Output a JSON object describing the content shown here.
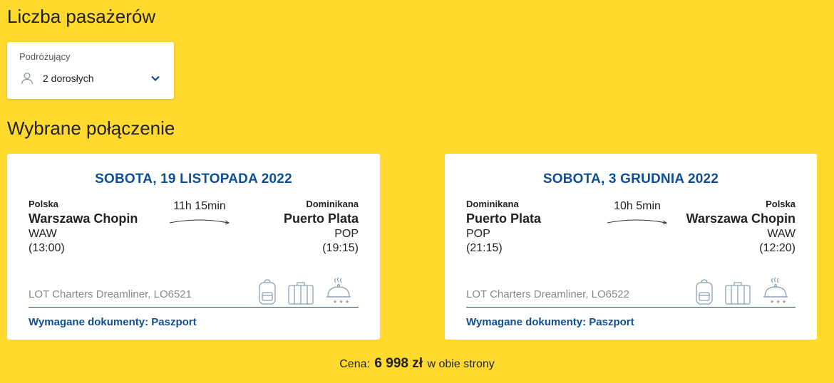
{
  "passengers": {
    "title": "Liczba pasażerów",
    "label": "Podróżujący",
    "value": "2 dorosłych"
  },
  "selected": {
    "title": "Wybrane połączenie"
  },
  "flights": [
    {
      "date": "SOBOTA, 19 LISTOPADA 2022",
      "from": {
        "country": "Polska",
        "city": "Warszawa Chopin",
        "code": "WAW",
        "time": "(13:00)"
      },
      "to": {
        "country": "Dominikana",
        "city": "Puerto Plata",
        "code": "POP",
        "time": "(19:15)"
      },
      "duration": "11h 15min",
      "flight": "LOT Charters Dreamliner, LO6521",
      "documents": "Wymagane dokumenty: Paszport"
    },
    {
      "date": "SOBOTA, 3 GRUDNIA 2022",
      "from": {
        "country": "Dominikana",
        "city": "Puerto Plata",
        "code": "POP",
        "time": "(21:15)"
      },
      "to": {
        "country": "Polska",
        "city": "Warszawa Chopin",
        "code": "WAW",
        "time": "(12:20)"
      },
      "duration": "10h 5min",
      "flight": "LOT Charters Dreamliner, LO6522",
      "documents": "Wymagane dokumenty: Paszport"
    }
  ],
  "price": {
    "label": "Cena:",
    "amount": "6 998 zł",
    "suffix": "w obie strony"
  },
  "colors": {
    "background": "#FFD92E",
    "accent": "#0E4E96"
  }
}
